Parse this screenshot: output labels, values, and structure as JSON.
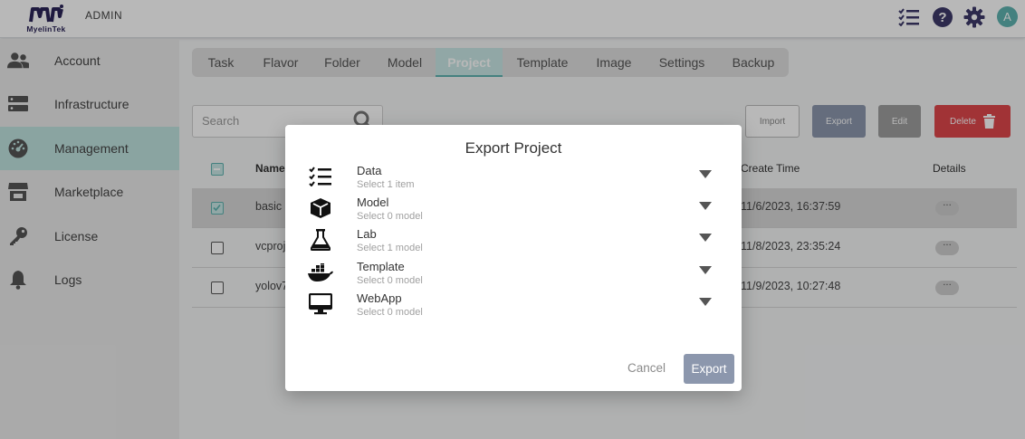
{
  "header": {
    "logo_text": "MyelinTek",
    "role": "ADMIN",
    "avatar_letter": "A"
  },
  "sidebar": {
    "items": [
      {
        "label": "Account",
        "icon": "account-icon"
      },
      {
        "label": "Infrastructure",
        "icon": "server-icon"
      },
      {
        "label": "Management",
        "icon": "dashboard-icon",
        "active": true
      },
      {
        "label": "Marketplace",
        "icon": "store-icon"
      },
      {
        "label": "License",
        "icon": "key-icon"
      },
      {
        "label": "Logs",
        "icon": "bell-icon"
      }
    ]
  },
  "tabs": [
    "Task",
    "Flavor",
    "Folder",
    "Model",
    "Project",
    "Template",
    "Image",
    "Settings",
    "Backup"
  ],
  "active_tab": "Project",
  "toolbar": {
    "search_placeholder": "Search",
    "import_label": "Import",
    "export_label": "Export",
    "edit_label": "Edit",
    "delete_label": "Delete"
  },
  "table": {
    "headers": {
      "name": "Name",
      "create_time": "Create Time",
      "details": "Details"
    },
    "rows": [
      {
        "name": "basic",
        "create_time": "11/6/2023, 16:37:59",
        "checked": true
      },
      {
        "name": "vcproj",
        "create_time": "11/8/2023, 23:35:24",
        "checked": false
      },
      {
        "name": "yolov7",
        "create_time": "11/9/2023, 10:27:48",
        "checked": false
      }
    ],
    "details_label": "···"
  },
  "modal": {
    "title": "Export Project",
    "rows": [
      {
        "name": "Data",
        "sub": "Select 1 item",
        "icon": "checklist-icon"
      },
      {
        "name": "Model",
        "sub": "Select 0 model",
        "icon": "cube-icon"
      },
      {
        "name": "Lab",
        "sub": "Select 1 model",
        "icon": "flask-icon"
      },
      {
        "name": "Template",
        "sub": "Select 0 model",
        "icon": "docker-icon"
      },
      {
        "name": "WebApp",
        "sub": "Select 0 model",
        "icon": "monitor-icon"
      }
    ],
    "cancel_label": "Cancel",
    "export_label": "Export"
  },
  "colors": {
    "accent": "#5fb3b0",
    "active_bg": "#bfe3e0",
    "delete": "#e0474c",
    "export_btn": "#8c97ad",
    "brand": "#2b2558"
  }
}
